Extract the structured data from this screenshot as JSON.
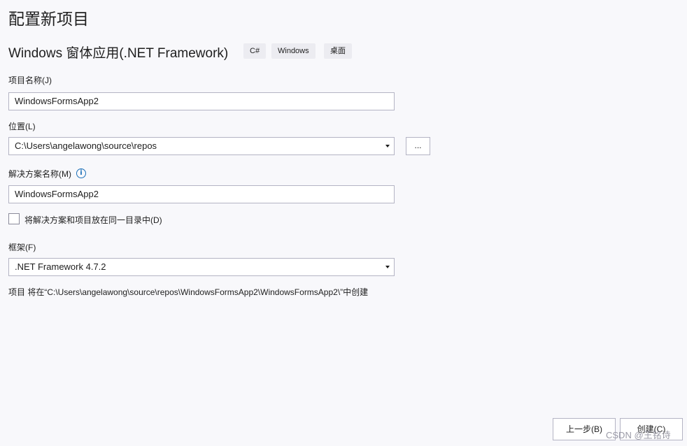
{
  "page": {
    "title": "配置新项目",
    "template_name": "Windows 窗体应用(.NET Framework)",
    "tags": [
      "C#",
      "Windows",
      "桌面"
    ]
  },
  "project_name": {
    "label": "项目名称(J)",
    "value": "WindowsFormsApp2"
  },
  "location": {
    "label": "位置(L)",
    "value": "C:\\Users\\angelawong\\source\\repos",
    "browse_label": "..."
  },
  "solution_name": {
    "label": "解决方案名称(M)",
    "info_icon": "info-icon",
    "value": "WindowsFormsApp2"
  },
  "same_dir_checkbox": {
    "label": "将解决方案和项目放在同一目录中(D)",
    "checked": false
  },
  "framework": {
    "label": "框架(F)",
    "value": ".NET Framework 4.7.2"
  },
  "path_note": "项目 将在“C:\\Users\\angelawong\\source\\repos\\WindowsFormsApp2\\WindowsFormsApp2\\”中创建",
  "footer": {
    "back_label": "上一步(B)",
    "create_label": "创建(C)"
  },
  "watermark": "CSDN @王铭诗",
  "colors": {
    "background": "#f8f8fb",
    "border": "#b4b4c4",
    "info_accent": "#1b6fb8"
  }
}
